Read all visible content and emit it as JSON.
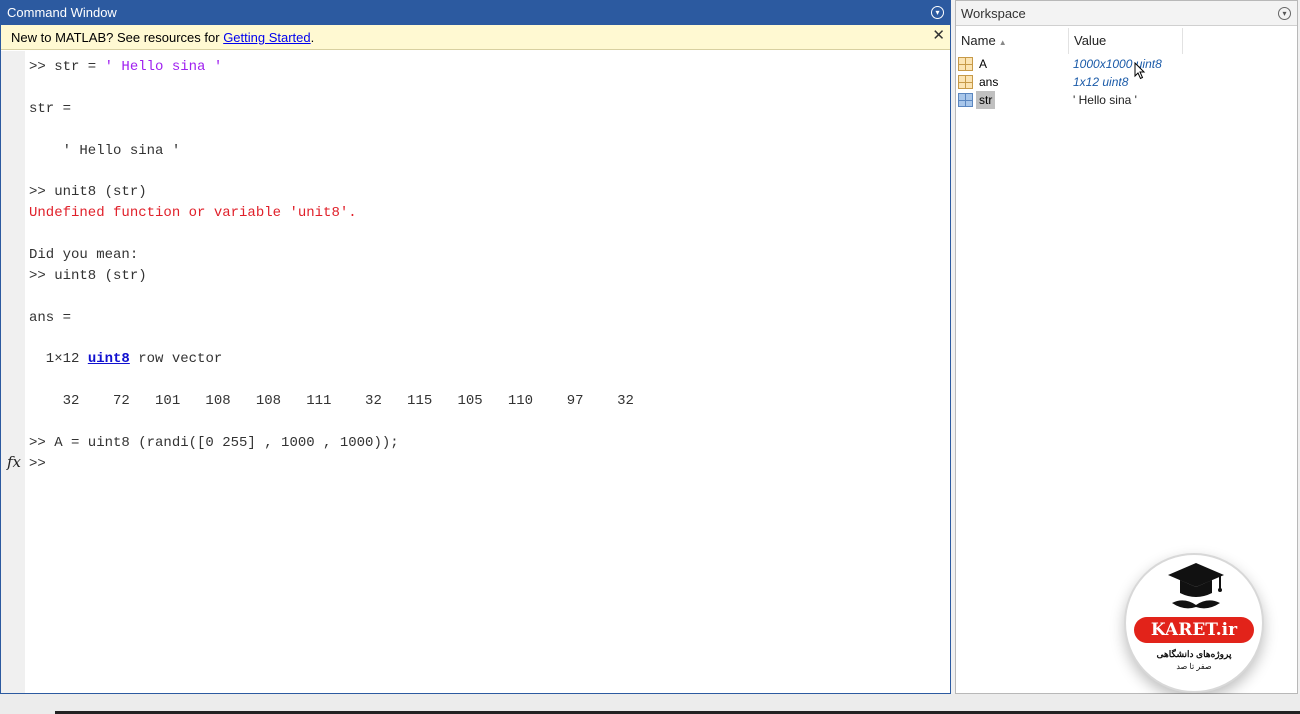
{
  "command_window": {
    "title": "Command Window",
    "banner": {
      "text": "New to MATLAB? See resources for ",
      "link": "Getting Started",
      "suffix": ".",
      "close": "✕"
    },
    "lines": {
      "l1_prompt": ">> str = ",
      "l1_str": "' Hello sina '",
      "l2": "str =",
      "l3": "    ' Hello sina '",
      "l4": ">> unit8 (str)",
      "l5": "Undefined function or variable 'unit8'.",
      "l6": "Did you mean:",
      "l7": ">> uint8 (str)",
      "l8": "ans =",
      "l9_pre": "  1×12 ",
      "l9_link": "uint8",
      "l9_post": " row vector",
      "l10": "    32    72   101   108   108   111    32   115   105   110    97    32",
      "l11": ">> A = uint8 (randi([0 255] , 1000 , 1000));",
      "l12": ">>"
    },
    "fx_icon": "fx"
  },
  "workspace": {
    "title": "Workspace",
    "columns": {
      "name": "Name",
      "value": "Value"
    },
    "variables": [
      {
        "name": "A",
        "value": "1000x1000 uint8",
        "icon": "matrix-icon"
      },
      {
        "name": "ans",
        "value": "1x12 uint8",
        "icon": "matrix-icon"
      },
      {
        "name": "str",
        "value": "' Hello sina '",
        "icon": "char-icon"
      }
    ]
  },
  "logo": {
    "brand": "KARET.ir",
    "tagline": "پروژه‌های دانشگاهی",
    "tagline2": "صفر تا صد"
  }
}
